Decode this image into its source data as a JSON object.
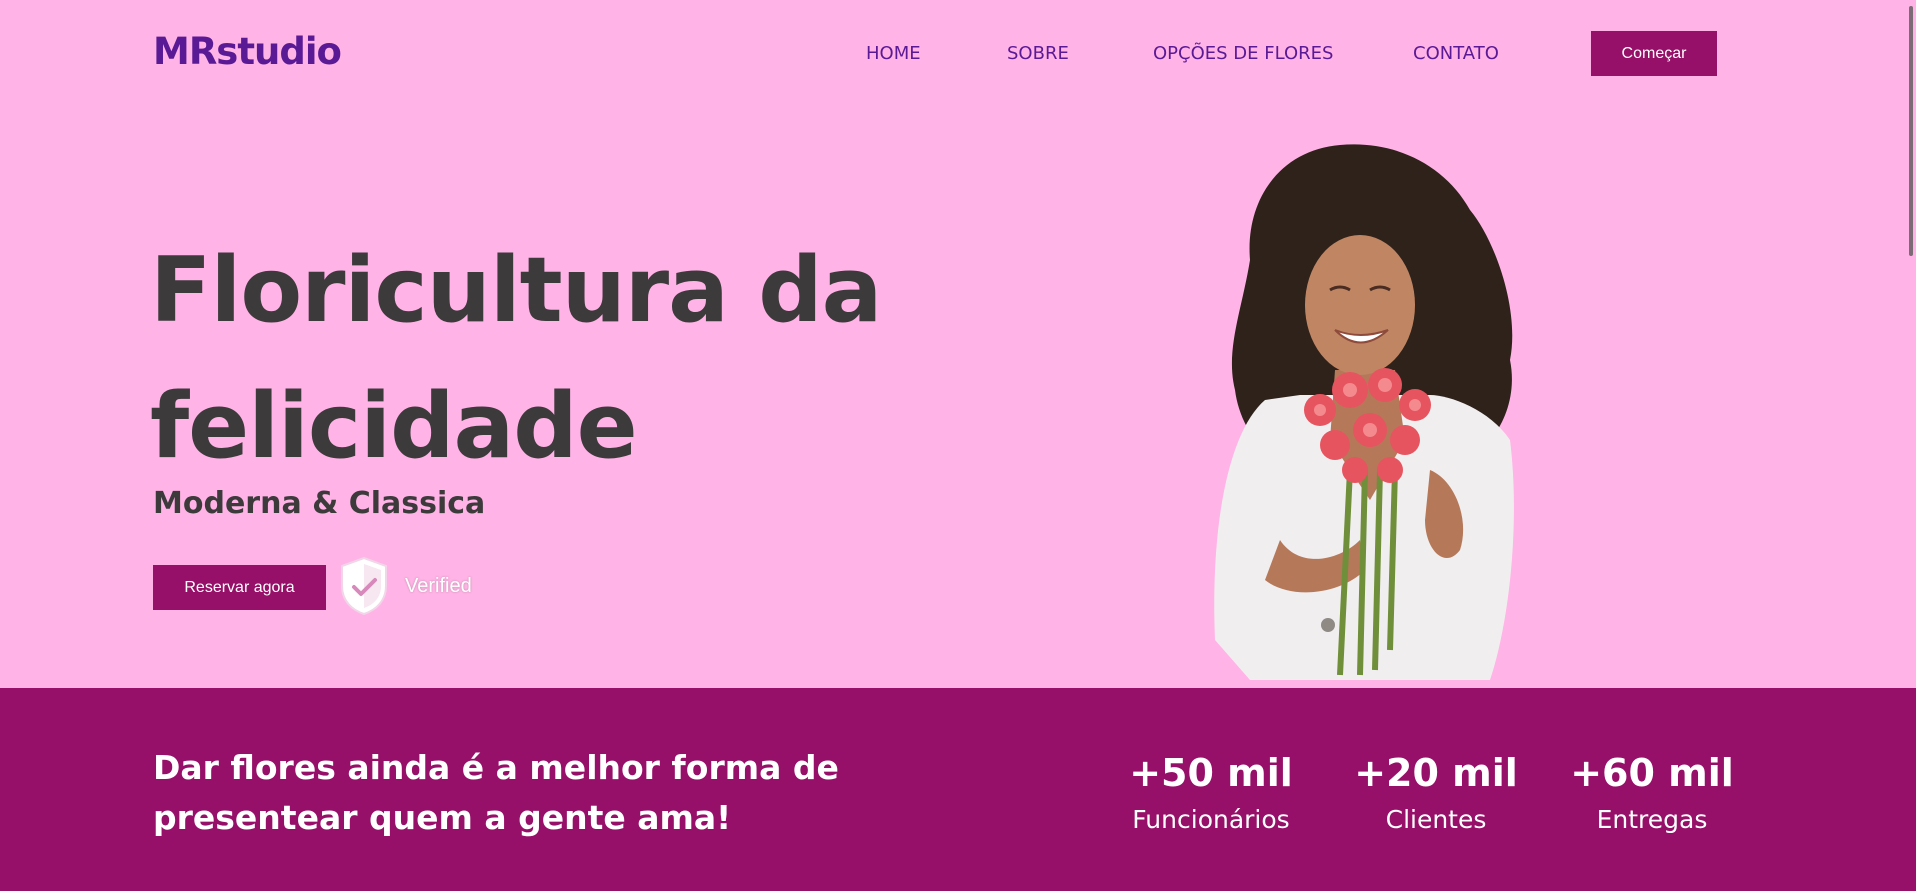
{
  "header": {
    "logo": "MRstudio",
    "nav": [
      "HOME",
      "SOBRE",
      "OPÇÕES DE FLORES",
      "CONTATO"
    ],
    "cta_label": "Começar"
  },
  "hero": {
    "title": "Floricultura da felicidade",
    "subtitle": "Moderna & Classica",
    "reserve_label": "Reservar agora",
    "verified_label": "Verified"
  },
  "band": {
    "text": "Dar flores ainda é a melhor forma de presentear quem a gente ama!",
    "stats": [
      {
        "value": "+50 mil",
        "label": "Funcionários"
      },
      {
        "value": "+20 mil",
        "label": "Clientes"
      },
      {
        "value": "+60 mil",
        "label": "Entregas"
      }
    ]
  },
  "colors": {
    "background": "#ffb3e6",
    "accent": "#960f68",
    "nav_text": "#5a1a96",
    "heading": "#3d3a3c"
  },
  "icons": {
    "verified_badge": "shield-check-icon"
  }
}
